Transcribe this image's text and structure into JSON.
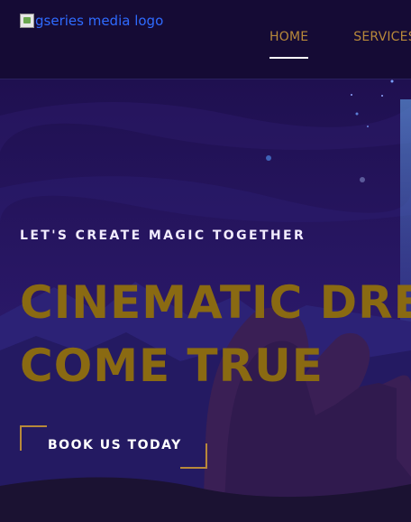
{
  "header": {
    "logo_alt": "gseries media logo",
    "nav": [
      {
        "label": "HOME",
        "active": true
      },
      {
        "label": "SERVICES",
        "active": false
      }
    ]
  },
  "hero": {
    "tagline": "LET'S CREATE MAGIC TOGETHER",
    "headline_line1": "CINEMATIC DREAMS",
    "headline_line2": "COME TRUE",
    "cta_label": "BOOK US TODAY"
  },
  "colors": {
    "header_bg": "#150b35",
    "accent_gold": "#b8893a",
    "headline_gold": "#8a6a12",
    "hero_bg": "#251460"
  }
}
